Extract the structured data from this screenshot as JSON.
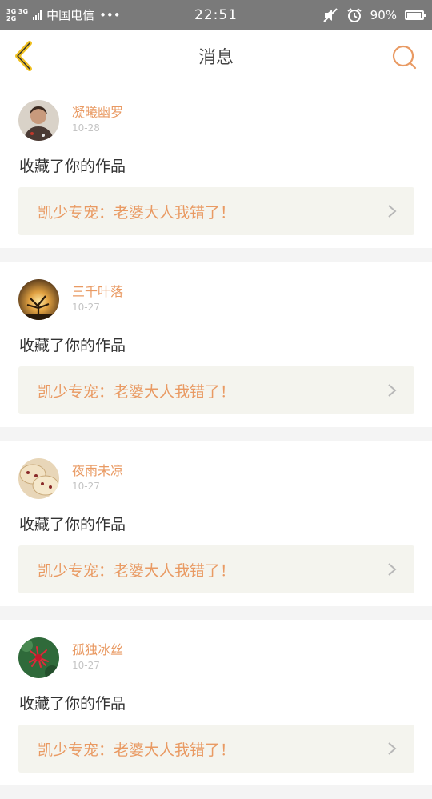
{
  "status_bar": {
    "network_top": "3G 3G",
    "network_bottom": "2G",
    "carrier": "中国电信",
    "dots": "•••",
    "time": "22:51",
    "battery": "90%",
    "battery_level": 0.9
  },
  "header": {
    "title": "消息"
  },
  "messages": [
    {
      "name": "凝曦幽罗",
      "date": "10-28",
      "action": "收藏了你的作品",
      "work_title": "凯少专宠：老婆大人我错了！",
      "avatar_icon": "avatar-man-photo"
    },
    {
      "name": "三千叶落",
      "date": "10-27",
      "action": "收藏了你的作品",
      "work_title": "凯少专宠：老婆大人我错了！",
      "avatar_icon": "avatar-sunset-tree"
    },
    {
      "name": "夜雨未凉",
      "date": "10-27",
      "action": "收藏了你的作品",
      "work_title": "凯少专宠：老婆大人我错了！",
      "avatar_icon": "avatar-biscuits"
    },
    {
      "name": "孤独冰丝",
      "date": "10-27",
      "action": "收藏了你的作品",
      "work_title": "凯少专宠：老婆大人我错了！",
      "avatar_icon": "avatar-red-flower"
    }
  ],
  "colors": {
    "accent": "#e99a63",
    "back_arrow": "#f0c020",
    "status_bar": "#7a7a7a"
  }
}
